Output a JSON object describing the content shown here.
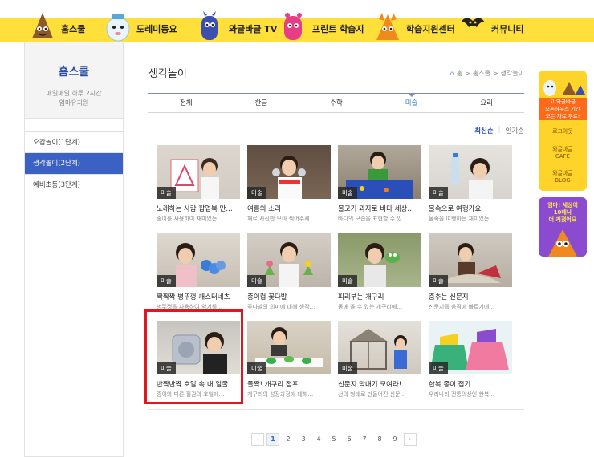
{
  "nav": {
    "items": [
      {
        "label": "홈스쿨"
      },
      {
        "label": "도레미동요"
      },
      {
        "label": "와글바글 TV"
      },
      {
        "label": "프린트 학습지"
      },
      {
        "label": "학습지원센터"
      },
      {
        "label": "커뮤니티"
      }
    ]
  },
  "sidebar": {
    "title": "홈스쿨",
    "subtitle_line1": "매일매일 하루 2시간",
    "subtitle_line2": "엄마유치원",
    "items": [
      {
        "label": "오감놀이(1단계)"
      },
      {
        "label": "생각놀이(2단계)"
      },
      {
        "label": "예비초등(3단계)"
      }
    ]
  },
  "main": {
    "title": "생각놀이",
    "breadcrumb": [
      "홈",
      "홈스쿨",
      "생각놀이"
    ],
    "tabs": [
      {
        "label": "전체"
      },
      {
        "label": "한글"
      },
      {
        "label": "수학"
      },
      {
        "label": "미술"
      },
      {
        "label": "요리"
      }
    ],
    "sort": {
      "latest": "최신순",
      "popular": "인기순"
    }
  },
  "cards": [
    {
      "badge": "미술",
      "title": "노래하는 사람 팝업북 만…",
      "desc": "종이를 사용하여 재미있는…"
    },
    {
      "badge": "미술",
      "title": "여름의 소리",
      "desc": "재료 사진만 모아 찍어주세…"
    },
    {
      "badge": "미술",
      "title": "물고기 과자로 바다 세상…",
      "desc": "바다의 모습을 표현할 수 있…"
    },
    {
      "badge": "미술",
      "title": "물속으로 여행가요",
      "desc": "물속을 여행하는 재미있는…"
    },
    {
      "badge": "미술",
      "title": "짝짝짝 병뚜껑 캐스터네츠",
      "desc": "병뚜껑을 사용하여 악기를…"
    },
    {
      "badge": "미술",
      "title": "종이컵 꽃다발",
      "desc": "꽃다발의 의미에 대해 생각…"
    },
    {
      "badge": "미술",
      "title": "피리부는 개구리",
      "desc": "몸에 올 수 있는 개구리에…"
    },
    {
      "badge": "미술",
      "title": "춤추는 신문지",
      "desc": "신문지를 움직에 빠르기에…"
    },
    {
      "badge": "미술",
      "title": "반짝반짝 호일 속 내 얼굴",
      "desc": "종이와 다른 질감의 호일에…"
    },
    {
      "badge": "미술",
      "title": "폴짝! 개구리 점프",
      "desc": "개구리의 성장과정에 대해…"
    },
    {
      "badge": "미술",
      "title": "신문지 막대기 모여라!",
      "desc": "선의 형태로 만들어진 신문…"
    },
    {
      "badge": "미술",
      "title": "한복 종이 접기",
      "desc": "우리나라 전통의상인 한복…"
    }
  ],
  "pagination": {
    "pages": [
      "1",
      "2",
      "3",
      "4",
      "5",
      "6",
      "7",
      "8",
      "9"
    ],
    "current": "1",
    "prev": "‹",
    "next": "›"
  },
  "quick": {
    "promo_line1": "고 와글바글",
    "promo_line2": "오픈하우스 기간",
    "promo_line3": "모든 자료 무료!",
    "logout": "로그아웃",
    "cafe_line1": "와글바글",
    "cafe_line2": "CAFE",
    "blog_line1": "와글바글",
    "blog_line2": "BLOG",
    "bottom_line1": "엄마! 세상이",
    "bottom_line2": "10배나",
    "bottom_line3": "더 커졌어요"
  },
  "colors": {
    "nav_yellow": "#ffe03a",
    "active_blue": "#3c61c4",
    "highlight_red": "#e0171f"
  }
}
